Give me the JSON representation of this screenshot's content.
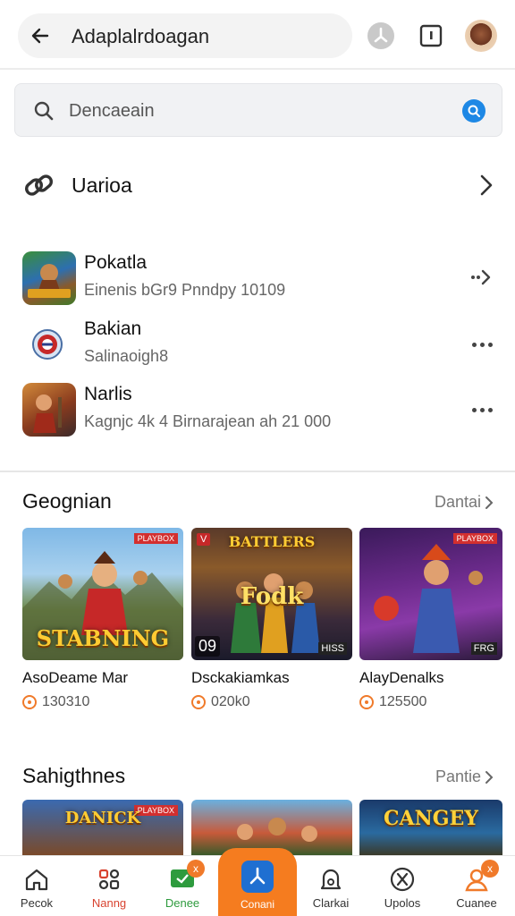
{
  "header": {
    "title": "Adaplalrdoagan"
  },
  "search": {
    "placeholder": "Dencaeain"
  },
  "section_link": {
    "label": "Uarioa"
  },
  "apps": [
    {
      "name": "Pokatla",
      "subtitle": "Einenis bGr9 Pnndpy 10109"
    },
    {
      "name": "Bakian",
      "subtitle": "Salinaoigh8"
    },
    {
      "name": "Narlis",
      "subtitle": "Kagnjc 4k 4 Birnarajean ah 21 000"
    }
  ],
  "section1": {
    "title": "Geognian",
    "more": "Dantai",
    "cards": [
      {
        "name": "AsoDeame Mar",
        "rating": "130310",
        "art_title": "STABNING",
        "badge_tr": "PLAYBOX"
      },
      {
        "name": "Dsckakiamkas",
        "rating": "020k0",
        "art_title": "Fodk",
        "top_title": "BATTLERS",
        "badge_tl": "V",
        "badge_bl": "09",
        "badge_br": "HISS"
      },
      {
        "name": "AlayDenalks",
        "rating": "125500",
        "badge_tr": "PLAYBOX",
        "badge_br": "FRG"
      }
    ]
  },
  "section2": {
    "title": "Sahigthnes",
    "more": "Pantie",
    "cards": [
      {
        "art_title": "DANICK",
        "badge_tr": "PLAYBOX"
      },
      {},
      {
        "art_title": "CANGEY"
      }
    ]
  },
  "bottom_nav": [
    {
      "label": "Pecok",
      "icon": "home-icon"
    },
    {
      "label": "Nanng",
      "icon": "grid-icon"
    },
    {
      "label": "Denee",
      "icon": "chat-icon",
      "badge": "x"
    },
    {
      "label": "Conani",
      "icon": "apps-icon"
    },
    {
      "label": "Clarkai",
      "icon": "bell-icon"
    },
    {
      "label": "Upolos",
      "icon": "compass-icon"
    },
    {
      "label": "Cuanee",
      "icon": "profile-icon",
      "badge": "x"
    }
  ],
  "colors": {
    "accent": "#f57c1f",
    "nav_green": "#2e9b3e",
    "nav_red": "#d84330",
    "search_assist": "#1e88e5"
  }
}
